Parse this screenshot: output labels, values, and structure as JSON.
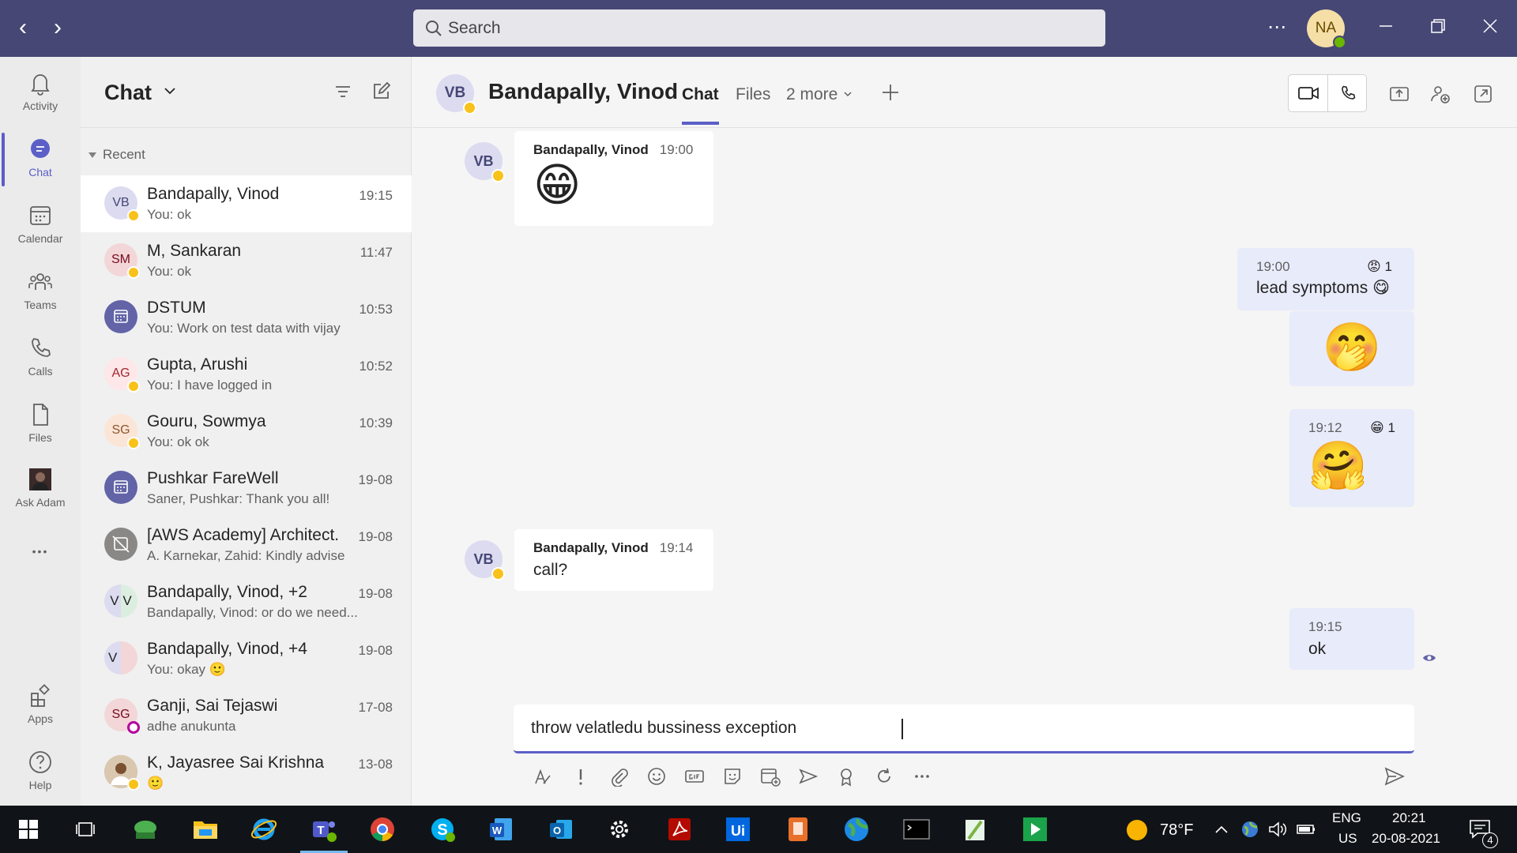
{
  "titlebar": {
    "search_placeholder": "Search",
    "more": "⋯",
    "avatar_initials": "NA",
    "back": "‹",
    "forward": "›"
  },
  "rail": [
    {
      "label": "Activity",
      "icon": "bell-icon"
    },
    {
      "label": "Chat",
      "icon": "chat-icon",
      "active": true
    },
    {
      "label": "Calendar",
      "icon": "calendar-icon"
    },
    {
      "label": "Teams",
      "icon": "teams-icon"
    },
    {
      "label": "Calls",
      "icon": "phone-icon"
    },
    {
      "label": "Files",
      "icon": "file-icon"
    },
    {
      "label": "Ask Adam",
      "icon": "ask-adam-app-icon"
    },
    {
      "label": "Apps",
      "icon": "apps-icon"
    },
    {
      "label": "Help",
      "icon": "help-icon"
    }
  ],
  "rail_more": "•••",
  "chatlist": {
    "title": "Chat",
    "section": "Recent",
    "items": [
      {
        "initials": "VB",
        "name": "Bandapally, Vinod",
        "preview": "You: ok",
        "time": "19:15"
      },
      {
        "initials": "SM",
        "name": "M, Sankaran",
        "preview": "You: ok",
        "time": "11:47"
      },
      {
        "initials": "",
        "name": "DSTUM",
        "preview": "You: Work on test data with vijay",
        "time": "10:53"
      },
      {
        "initials": "AG",
        "name": "Gupta, Arushi",
        "preview": "You: I have logged in",
        "time": "10:52"
      },
      {
        "initials": "SG",
        "name": "Gouru, Sowmya",
        "preview": "You: ok ok",
        "time": "10:39"
      },
      {
        "initials": "",
        "name": "Pushkar FareWell",
        "preview": "Saner, Pushkar: Thank you all!",
        "time": "19-08"
      },
      {
        "initials": "",
        "name": "[AWS Academy] Architect...",
        "preview": "A. Karnekar, Zahid: Kindly advise",
        "time": "19-08"
      },
      {
        "initials": "V V",
        "name": "Bandapally, Vinod, +2",
        "preview": "Bandapally, Vinod: or do we need...",
        "time": "19-08"
      },
      {
        "initials": "V",
        "name": "Bandapally, Vinod, +4",
        "preview": "You: okay 🙂",
        "time": "19-08"
      },
      {
        "initials": "SG",
        "name": "Ganji, Sai Tejaswi",
        "preview": "adhe anukunta",
        "time": "17-08"
      },
      {
        "initials": "",
        "name": "K, Jayasree Sai Krishna",
        "preview": "🙂",
        "time": "13-08"
      }
    ]
  },
  "main": {
    "avatar_initials": "VB",
    "name": "Bandapally, Vinod",
    "tabs": [
      "Chat",
      "Files",
      "2 more"
    ],
    "messages": [
      {
        "author": "Bandapally, Vinod",
        "time": "19:00",
        "emoji": "😁"
      },
      {
        "time": "19:00",
        "text": "lead symptoms",
        "inline_emoji": "😋",
        "reaction_emoji": "😡",
        "reaction_count": "1"
      },
      {
        "emoji": "🤭"
      },
      {
        "time": "19:12",
        "emoji": "🤗",
        "reaction_emoji": "😁",
        "reaction_count": "1"
      },
      {
        "author": "Bandapally, Vinod",
        "time": "19:14",
        "text": "call?"
      },
      {
        "time": "19:15",
        "text": "ok"
      }
    ],
    "composer_text": "throw velatledu bussiness exception"
  },
  "taskbar": {
    "temp": "78°F",
    "lang_top": "ENG",
    "lang_bottom": "US",
    "time": "20:21",
    "date": "20-08-2021",
    "notif_count": "4"
  }
}
